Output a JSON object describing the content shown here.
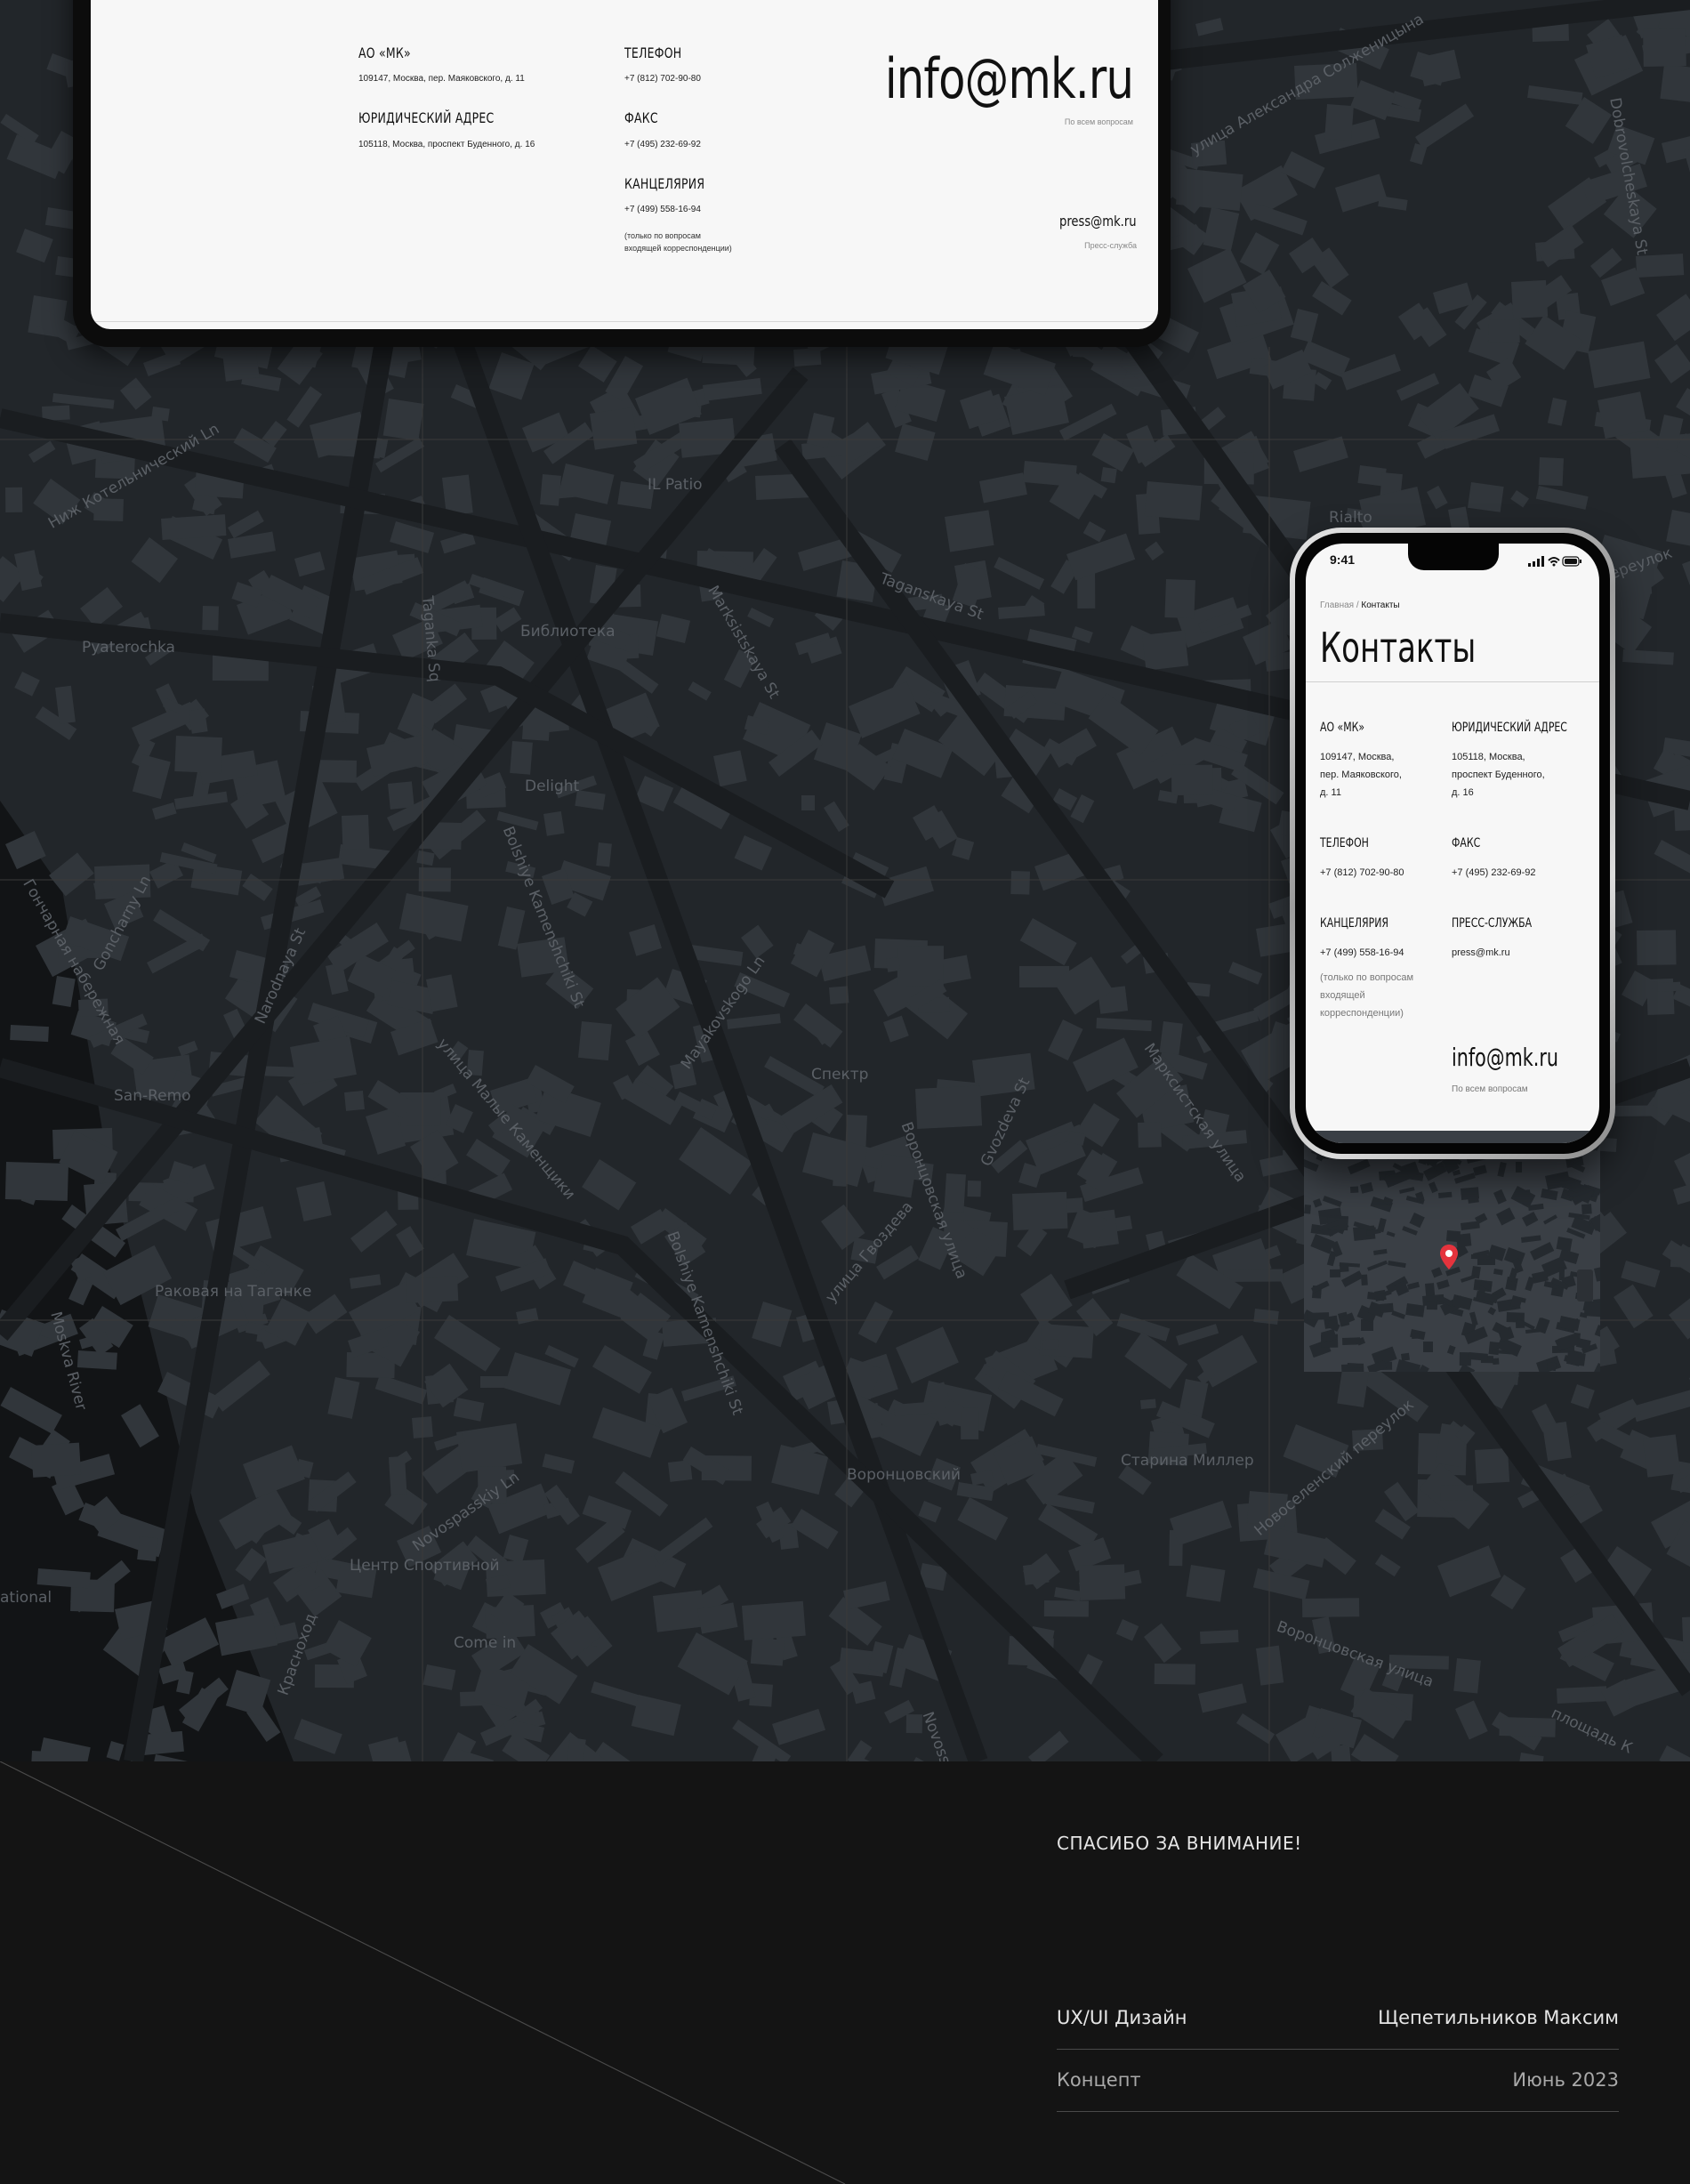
{
  "laptop": {
    "company_heading": "АО «МК»",
    "company_address": "109147, Москва, пер. Маяковского, д. 11",
    "legal_heading": "ЮРИДИЧЕСКИЙ АДРЕС",
    "legal_address": "105118, Москва, проспект Буденного, д. 16",
    "phone_heading": "ТЕЛЕФОН",
    "phone_value": "+7 (812) 702-90-80",
    "fax_heading": "ФАКС",
    "fax_value": "+7 (495) 232-69-92",
    "office_heading": "КАНЦЕЛЯРИЯ",
    "office_value": "+7 (499) 558-16-94",
    "office_note_1": "(только по вопросам",
    "office_note_2": "входящей корреспонденции)",
    "email_main": "info@mk.ru",
    "email_main_caption": "По всем вопросам",
    "email_press": "press@mk.ru",
    "email_press_caption": "Пресс-служба"
  },
  "map_labels": [
    "IL Patio",
    "Taganskaya St",
    "Marksistskaya St",
    "Taganka Sq",
    "Библиотека",
    "Pyaterochka",
    "Delight",
    "Bolshiye Kamenshchiki St",
    "Mayakovskogo Ln",
    "Goncharny Ln",
    "Narodnaya St",
    "улица Малые Каменщики",
    "Спектр",
    "Воронцовская улица",
    "Gvozdeva St",
    "улица Гвоздева",
    "San-Remo",
    "Раковая на Таганке",
    "Moskva River",
    "Bolshiye Kamenshchiki St",
    "Марксистская улица",
    "Воронцовский",
    "Старина Миллер",
    "Novospasskiy Ln",
    "Центр Спортивной",
    "Come in",
    "Красноход",
    "Новоселенский переулок",
    "Воронцовская улица",
    "площадь К",
    "улица Александра Солженицына",
    "Dobrovolcheskaya St",
    "Rialto",
    "Гончарная набережная",
    "ational",
    "Novoss",
    "переулок",
    "Ниж Котельнический Ln"
  ],
  "phone": {
    "time": "9:41",
    "breadcrumb_home": "Главная",
    "breadcrumb_sep": " / ",
    "breadcrumb_current": "Контакты",
    "title": "Контакты",
    "company_heading": "АО «МК»",
    "company_address_1": "109147, Москва,",
    "company_address_2": "пер. Маяковского,",
    "company_address_3": "д. 11",
    "legal_heading": "ЮРИДИЧЕСКИЙ АДРЕС",
    "legal_address_1": "105118, Москва,",
    "legal_address_2": "проспект Буденного,",
    "legal_address_3": "д. 16",
    "phone_heading": "ТЕЛЕФОН",
    "phone_value": "+7 (812) 702-90-80",
    "fax_heading": "ФАКС",
    "fax_value": "+7 (495) 232-69-92",
    "office_heading": "КАНЦЕЛЯРИЯ",
    "office_value": "+7 (499) 558-16-94",
    "office_note_1": "(только по вопросам",
    "office_note_2": "входящей",
    "office_note_3": "корреспонденции)",
    "press_heading": "ПРЕСС-СЛУЖБА",
    "press_value": "press@mk.ru",
    "email_main": "info@mk.ru",
    "email_caption": "По всем вопросам"
  },
  "footer": {
    "thanks": "СПАСИБО ЗА ВНИМАНИЕ!",
    "row1_left": "UX/UI Дизайн",
    "row1_right": "Щепетильников Максим",
    "row2_left": "Концепт",
    "row2_right": "Июнь 2023"
  },
  "colors": {
    "map_bg": "#22262a",
    "map_block": "#31363b",
    "footer_bg": "#141414",
    "pin": "#e5333d"
  }
}
